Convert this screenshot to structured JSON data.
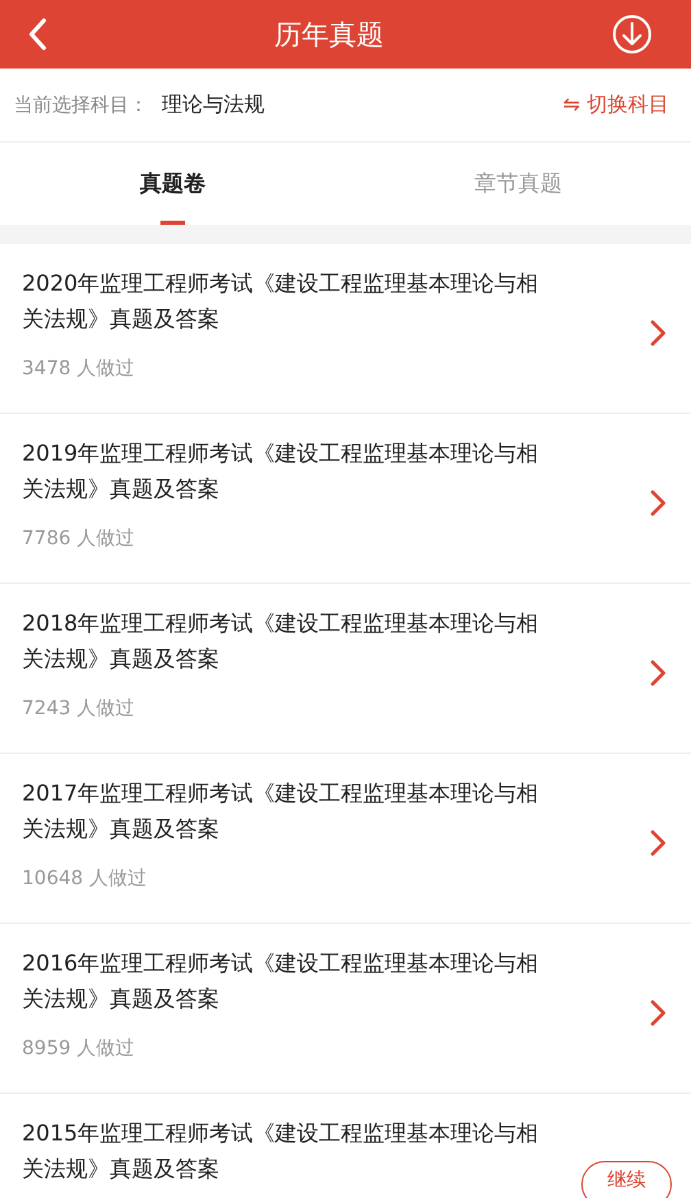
{
  "header": {
    "title": "历年真题"
  },
  "subject": {
    "label": "当前选择科目：",
    "value": "理论与法规",
    "switch": "切换科目",
    "switch_icon": "⇋"
  },
  "tabs": [
    {
      "label": "真题卷",
      "selected": true
    },
    {
      "label": "章节真题",
      "selected": false
    }
  ],
  "papers": [
    {
      "title": "2020年监理工程师考试《建设工程监理基本理论与相关法规》真题及答案",
      "count": "3478 人做过"
    },
    {
      "title": "2019年监理工程师考试《建设工程监理基本理论与相关法规》真题及答案",
      "count": "7786 人做过"
    },
    {
      "title": "2018年监理工程师考试《建设工程监理基本理论与相关法规》真题及答案",
      "count": "7243 人做过"
    },
    {
      "title": "2017年监理工程师考试《建设工程监理基本理论与相关法规》真题及答案",
      "count": "10648 人做过"
    },
    {
      "title": "2016年监理工程师考试《建设工程监理基本理论与相关法规》真题及答案",
      "count": "8959 人做过"
    },
    {
      "title": "2015年监理工程师考试《建设工程监理基本理论与相关法规》真题及答案"
    }
  ],
  "continue_button": "继续"
}
